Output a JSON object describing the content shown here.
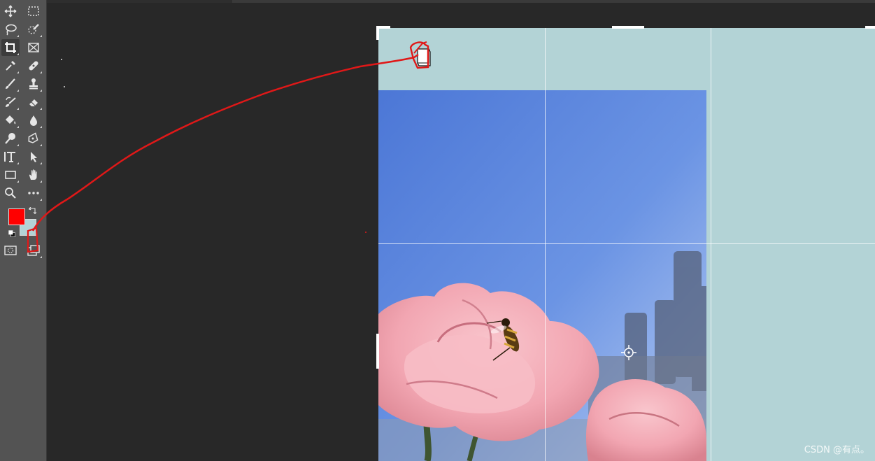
{
  "colors": {
    "foreground": "#ff0000",
    "background": "#b3d3d6",
    "canvas_fill": "#b3d3d6",
    "workspace": "#282828",
    "toolbar": "#535353",
    "annotation": "#e01818"
  },
  "tools": [
    {
      "name": "move-tool",
      "icon": "move-icon"
    },
    {
      "name": "marquee-tool",
      "icon": "rect-marquee-icon"
    },
    {
      "name": "lasso-tool",
      "icon": "lasso-icon"
    },
    {
      "name": "quick-select-tool",
      "icon": "quick-select-icon"
    },
    {
      "name": "crop-tool",
      "icon": "crop-icon",
      "active": true
    },
    {
      "name": "frame-tool",
      "icon": "frame-icon"
    },
    {
      "name": "eyedropper-tool",
      "icon": "eyedropper-icon"
    },
    {
      "name": "healing-tool",
      "icon": "bandage-icon"
    },
    {
      "name": "brush-tool",
      "icon": "brush-icon"
    },
    {
      "name": "stamp-tool",
      "icon": "stamp-icon"
    },
    {
      "name": "history-brush-tool",
      "icon": "history-brush-icon"
    },
    {
      "name": "eraser-tool",
      "icon": "eraser-icon"
    },
    {
      "name": "paint-bucket-tool",
      "icon": "paint-bucket-icon"
    },
    {
      "name": "blur-tool",
      "icon": "drop-icon"
    },
    {
      "name": "dodge-tool",
      "icon": "dodge-icon"
    },
    {
      "name": "pen-tool",
      "icon": "pen-icon"
    },
    {
      "name": "type-tool",
      "icon": "type-icon"
    },
    {
      "name": "path-select-tool",
      "icon": "arrow-select-icon"
    },
    {
      "name": "shape-tool",
      "icon": "rectangle-icon"
    },
    {
      "name": "hand-tool",
      "icon": "hand-icon"
    },
    {
      "name": "zoom-tool",
      "icon": "zoom-icon"
    },
    {
      "name": "more-tools",
      "icon": "ellipsis-icon"
    }
  ],
  "watermark": "CSDN @有点。"
}
